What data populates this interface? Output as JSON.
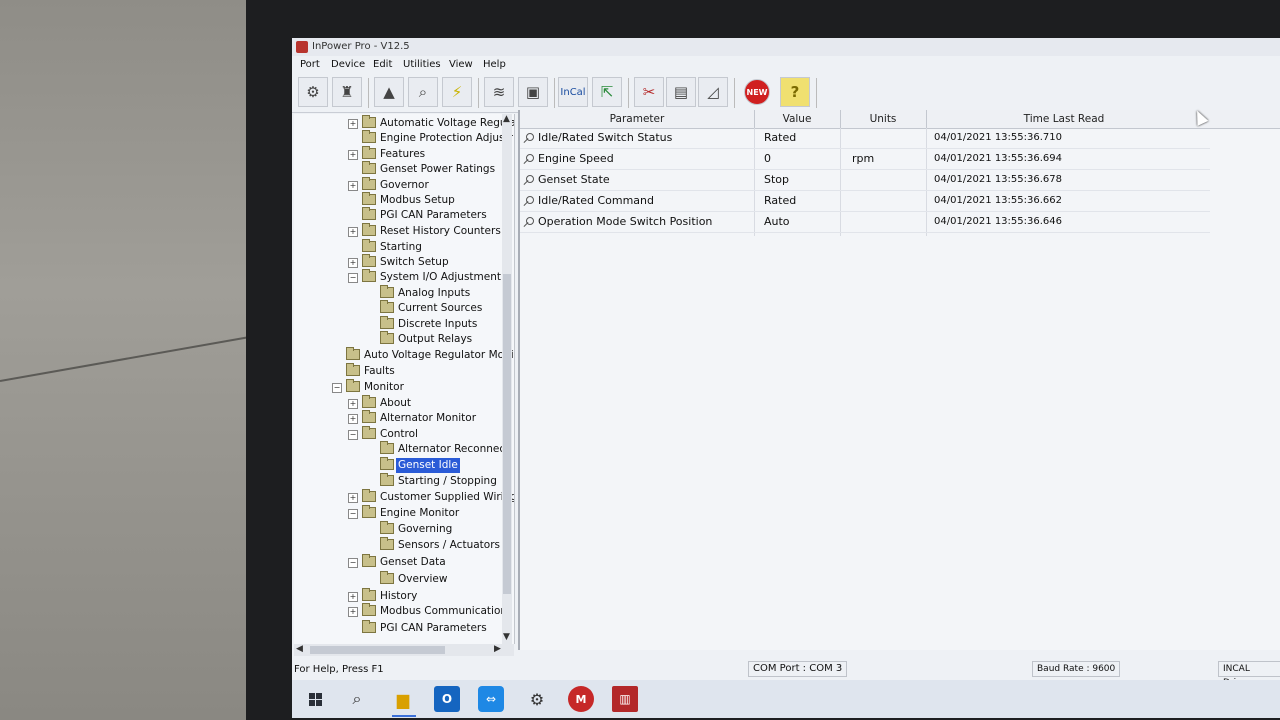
{
  "window": {
    "title": "InPower Pro - V12.5"
  },
  "menu": [
    "Port",
    "Device",
    "Edit",
    "Utilities",
    "View",
    "Help"
  ],
  "toolbar": {
    "incal_label": "InCal",
    "new_label": "NEW",
    "help_label": "?",
    "icons": [
      "connect-icon",
      "device-icon",
      "alarm-icon",
      "zoom-icon",
      "lightning-icon",
      "capture-icon",
      "compare-icon",
      "incal-icon",
      "export-icon",
      "tools-icon",
      "save-icon",
      "chart-icon",
      "new-icon",
      "help-icon"
    ]
  },
  "tree": {
    "items": [
      "Automatic Voltage Regula",
      "Engine Protection Adjustr",
      "Features",
      "Genset Power Ratings",
      "Governor",
      "Modbus Setup",
      "PGI CAN Parameters",
      "Reset History Counters",
      "Starting",
      "Switch Setup",
      "System I/O Adjustment",
      "Analog Inputs",
      "Current Sources",
      "Discrete Inputs",
      "Output Relays",
      "Auto Voltage Regulator Moni",
      "Faults",
      "Monitor",
      "About",
      "Alternator Monitor",
      "Control",
      "Alternator Reconnecti",
      "Genset Idle",
      "Starting / Stopping",
      "Customer Supplied Wiring",
      "Engine Monitor",
      "Governing",
      "Sensors / Actuators",
      "Genset Data",
      "Overview",
      "History",
      "Modbus Communication:",
      "PGI CAN Parameters"
    ],
    "selected": "Genset Idle"
  },
  "grid": {
    "headers": {
      "parameter": "Parameter",
      "value": "Value",
      "units": "Units",
      "time": "Time Last Read"
    },
    "rows": [
      {
        "parameter": "Idle/Rated Switch Status",
        "value": "Rated",
        "units": "",
        "time": "04/01/2021 13:55:36.710"
      },
      {
        "parameter": "Engine Speed",
        "value": "0",
        "units": "rpm",
        "time": "04/01/2021 13:55:36.694"
      },
      {
        "parameter": "Genset State",
        "value": "Stop",
        "units": "",
        "time": "04/01/2021 13:55:36.678"
      },
      {
        "parameter": "Idle/Rated Command",
        "value": "Rated",
        "units": "",
        "time": "04/01/2021 13:55:36.662"
      },
      {
        "parameter": "Operation Mode Switch Position",
        "value": "Auto",
        "units": "",
        "time": "04/01/2021 13:55:36.646"
      }
    ]
  },
  "status": {
    "help": "For Help, Press F1",
    "com_port": "COM Port : COM 3",
    "baud_rate": "Baud Rate : 9600",
    "driver": "INCAL Drive"
  },
  "taskbar": {
    "icons": [
      "windows-start-icon",
      "search-icon",
      "file-explorer-icon",
      "outlook-icon",
      "teamviewer-icon",
      "settings-icon",
      "mcafee-icon",
      "inpower-icon"
    ]
  }
}
